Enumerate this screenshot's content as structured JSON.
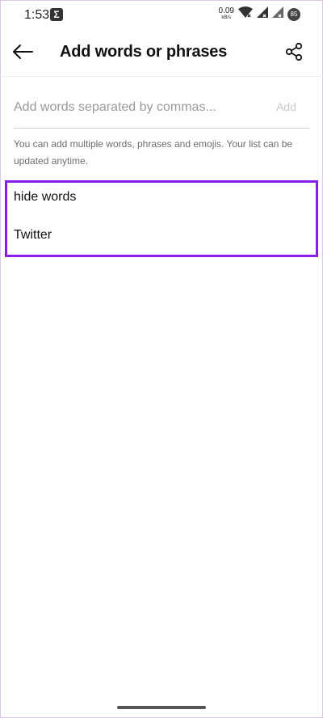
{
  "status_bar": {
    "time": "1:53",
    "app_icon_glyph": "Σ",
    "net_speed_value": "0.09",
    "net_speed_unit": "kB/s",
    "battery_level": "85"
  },
  "header": {
    "title": "Add words or phrases",
    "back_icon": "arrow-left-icon",
    "share_icon": "share-icon"
  },
  "input": {
    "placeholder": "Add words separated by commas...",
    "value": "",
    "add_label": "Add"
  },
  "helper_text": "You can add multiple words, phrases and emojis. Your list can be updated anytime.",
  "words": [
    "hide words",
    "Twitter"
  ],
  "colors": {
    "highlight": "#8a1cf0",
    "add_disabled": "#c9c9c9",
    "helper": "#6d6d6d"
  }
}
